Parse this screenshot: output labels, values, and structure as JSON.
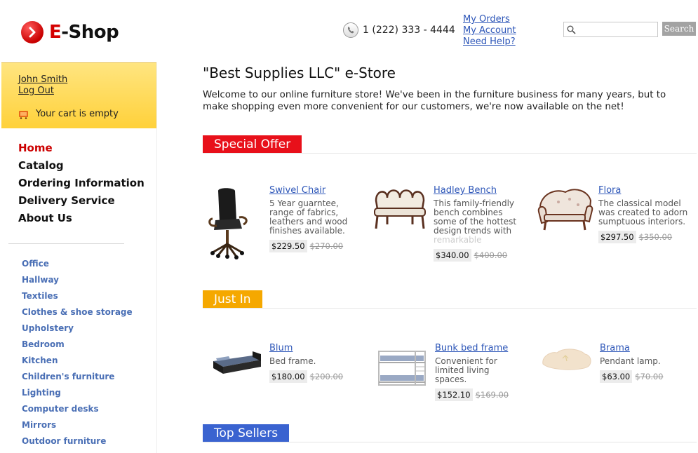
{
  "header": {
    "brand_prefix": "E",
    "brand_suffix": "-Shop",
    "phone": "1 (222) 333 - 4444",
    "links": [
      "My Orders",
      "My Account",
      "Need Help?"
    ],
    "search": {
      "placeholder": "",
      "button": "Search"
    }
  },
  "user": {
    "name": "John Smith",
    "logout": "Log Out",
    "cart_status": "Your cart is empty"
  },
  "main_nav": [
    "Home",
    "Catalog",
    "Ordering Information",
    "Delivery Service",
    "About Us"
  ],
  "categories": [
    "Office",
    "Hallway",
    "Textiles",
    "Clothes & shoe storage",
    "Upholstery",
    "Bedroom",
    "Kitchen",
    "Children's furniture",
    "Lighting",
    "Computer desks",
    "Mirrors",
    "Outdoor furniture"
  ],
  "store": {
    "title": "\"Best Supplies LLC\" e-Store",
    "welcome": "Welcome to our online furniture store! We've been in the furniture business for many years, but to make shopping even more convenient for our customers, we're now available on the net!"
  },
  "sections": {
    "special": {
      "title": "Special Offer",
      "color": "#e8101a",
      "products": [
        {
          "name": "Swivel Chair",
          "desc": "5 Year guarntee, range of fabrics, leathers and wood finishes available.",
          "price": "$229.50",
          "old_price": "$270.00"
        },
        {
          "name": "Hadley Bench",
          "desc": "This family-friendly bench combines some of the hottest design trends with",
          "desc_fade": "remarkable",
          "price": "$340.00",
          "old_price": "$400.00"
        },
        {
          "name": "Flora",
          "desc": "The classical model was created to adorn sumptuous interiors.",
          "price": "$297.50",
          "old_price": "$350.00"
        }
      ]
    },
    "justin": {
      "title": "Just In",
      "color": "#f5a800",
      "products": [
        {
          "name": "Blum",
          "desc": "Bed frame.",
          "price": "$180.00",
          "old_price": "$200.00"
        },
        {
          "name": "Bunk bed frame",
          "desc": "Convenient for limited living spaces.",
          "price": "$152.10",
          "old_price": "$169.00"
        },
        {
          "name": "Brama",
          "desc": "Pendant lamp.",
          "price": "$63.00",
          "old_price": "$70.00"
        }
      ]
    },
    "topsellers": {
      "title": "Top Sellers",
      "color": "#3a63d0"
    }
  }
}
